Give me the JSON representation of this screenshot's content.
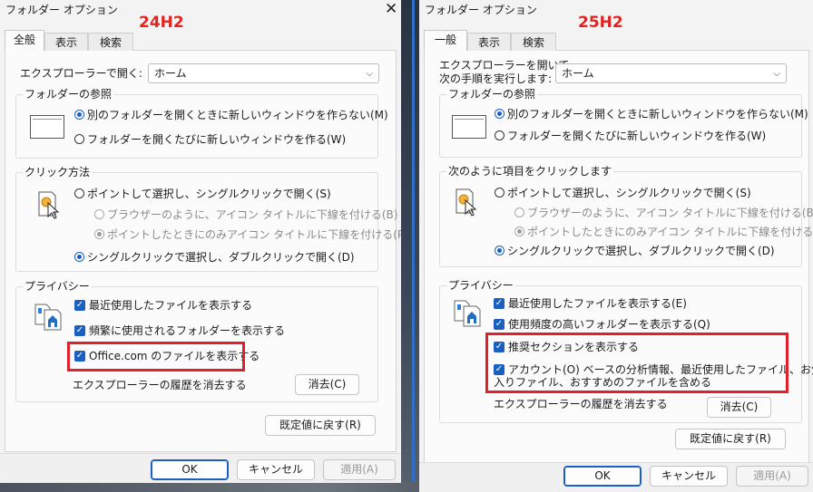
{
  "left": {
    "title": "フォルダー オプション",
    "version": "24H2",
    "tabs": [
      "全般",
      "表示",
      "検索"
    ],
    "open_label": "エクスプローラーで開く:",
    "open_value": "ホーム",
    "browse_group": "フォルダーの参照",
    "browse_opt1": "別のフォルダーを開くときに新しいウィンドウを作らない(M)",
    "browse_opt2": "フォルダーを開くたびに新しいウィンドウを作る(W)",
    "click_group": "クリック方法",
    "click_opt1": "ポイントして選択し、シングルクリックで開く(S)",
    "click_sub1": "ブラウザーのように、アイコン タイトルに下線を付ける(B)",
    "click_sub2": "ポイントしたときにのみアイコン タイトルに下線を付ける(P)",
    "click_opt2": "シングルクリックで選択し、ダブルクリックで開く(D)",
    "privacy_group": "プライバシー",
    "privacy_chk1": "最近使用したファイルを表示する",
    "privacy_chk2": "頻繁に使用されるフォルダーを表示する",
    "privacy_chk3": "Office.com のファイルを表示する",
    "history_label": "エクスプローラーの履歴を消去する",
    "clear_btn": "消去(C)",
    "restore_btn": "既定値に戻す(R)",
    "ok": "OK",
    "cancel": "キャンセル",
    "apply": "適用(A)"
  },
  "right": {
    "title": "フォルダー オプション",
    "version": "25H2",
    "tabs": [
      "一般",
      "表示",
      "検索"
    ],
    "open_label_1": "エクスプローラーを開いて、",
    "open_label_2": "次の手順を実行します:",
    "open_value": "ホーム",
    "browse_group": "フォルダーの参照",
    "browse_opt1": "別のフォルダーを開くときに新しいウィンドウを作らない(M)",
    "browse_opt2": "フォルダーを開くたびに新しいウィンドウを作る(W)",
    "click_group": "次のように項目をクリックします",
    "click_opt1": "ポイントして選択し、シングルクリックで開く(S)",
    "click_sub1": "ブラウザーのように、アイコン タイトルに下線を付ける(B)",
    "click_sub2": "ポイントしたときにのみアイコン タイトルに下線を付ける(P)",
    "click_opt2": "シングルクリックで選択し、ダブルクリックで開く(D)",
    "privacy_group": "プライバシー",
    "privacy_chk1": "最近使用したファイルを表示する(E)",
    "privacy_chk2": "使用頻度の高いフォルダーを表示する(Q)",
    "privacy_chk3": "推奨セクションを表示する",
    "privacy_chk4_1": "アカウント(O) ベースの分析情報、最近使用したファイル、お気に",
    "privacy_chk4_2": "入りファイル、おすすめのファイルを含める",
    "history_label": "エクスプローラーの履歴を消去する",
    "clear_btn": "消去(C)",
    "restore_btn": "既定値に戻す(R)",
    "ok": "OK",
    "cancel": "キャンセル",
    "apply": "適用(A)"
  },
  "icons": {
    "close": "✕",
    "check": "✓",
    "chevron": "⌵"
  },
  "colors": {
    "accent": "#1b5fc1",
    "highlight": "#e0202a",
    "version": "#e02420"
  }
}
